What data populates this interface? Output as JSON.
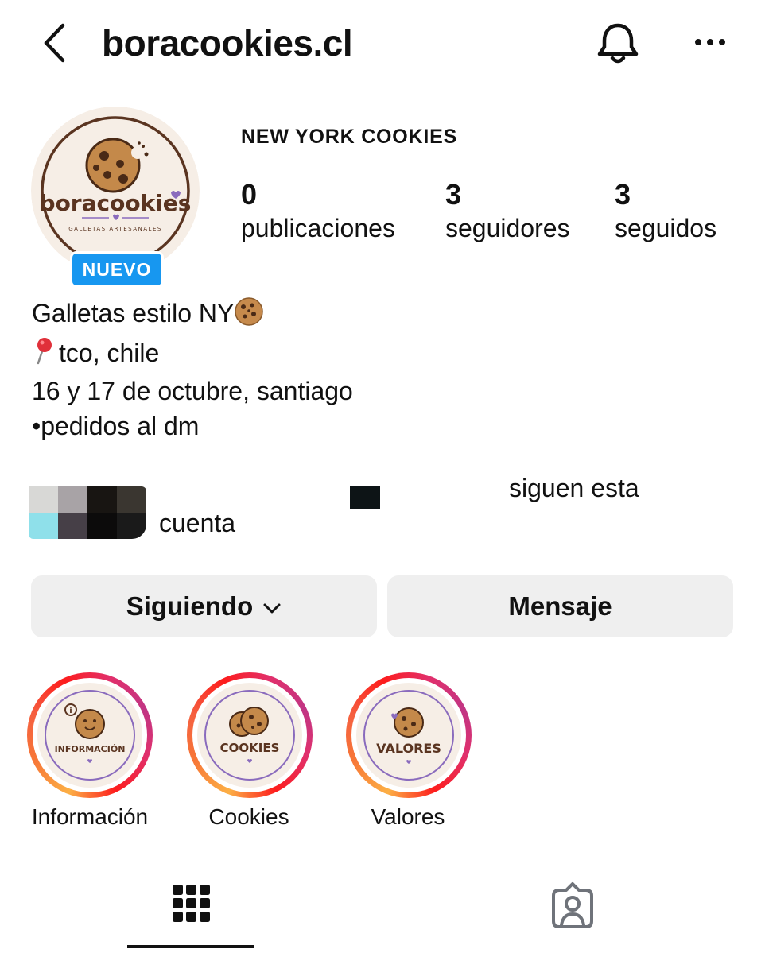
{
  "header": {
    "username": "boracookies.cl",
    "back_icon": "chevron-left-icon",
    "notification_icon": "bell-icon",
    "more_icon": "more-horizontal-icon"
  },
  "profile": {
    "display_name": "NEW YORK COOKIES",
    "avatar": {
      "brand": "boracookies",
      "tagline": "GALLETAS ARTESANALES"
    },
    "new_badge": "NUEVO",
    "stats": [
      {
        "number": "0",
        "label": "publicaciones"
      },
      {
        "number": "3",
        "label": "seguidores"
      },
      {
        "number": "3",
        "label": "seguidos"
      }
    ],
    "bio": {
      "line1": "Galletas estilo NY",
      "line2": "tco, chile",
      "line3": "16 y 17 de octubre, santiago",
      "line4": "•pedidos al dm"
    }
  },
  "followed_by": {
    "text_a": "siguen esta",
    "text_b": "cuenta"
  },
  "actions": {
    "following_label": "Siguiendo",
    "message_label": "Mensaje"
  },
  "highlights": [
    {
      "label": "Información",
      "cover_text": "INFORMACIÓN"
    },
    {
      "label": "Cookies",
      "cover_text": "COOKIES"
    },
    {
      "label": "Valores",
      "cover_text": "VALORES"
    }
  ],
  "tabs": {
    "grid_icon": "grid-icon",
    "tagged_icon": "tagged-person-icon"
  },
  "colors": {
    "badge_blue": "#1797f0",
    "button_bg": "#efefef",
    "avatar_bg": "#f6eee6",
    "cookie_brown": "#5a3420",
    "accent_purple": "#8a6bbd"
  }
}
